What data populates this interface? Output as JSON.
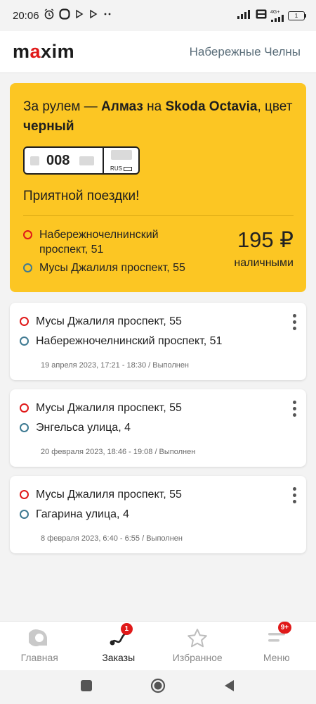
{
  "status_bar": {
    "time": "20:06",
    "network": "4G+",
    "battery": "1"
  },
  "header": {
    "logo_left": "m",
    "logo_accent": "a",
    "logo_right": "xim",
    "city": "Набережные Челны"
  },
  "active_order": {
    "driver_prefix": "За рулем — ",
    "driver_name": "Алмаз",
    "car_prefix": " на ",
    "car": "Skoda Octavia",
    "color_prefix": ", цвет ",
    "color": "черный",
    "plate_number": "008",
    "plate_country": "RUS",
    "greeting": "Приятной поездки!",
    "from": "Набережночелнинский проспект, 51",
    "to": "Мусы Джалиля проспект, 55",
    "price": "195 ₽",
    "payment": "наличными"
  },
  "history": [
    {
      "from": "Мусы Джалиля проспект, 55",
      "to": "Набережночелнинский проспект, 51",
      "meta": "19 апреля 2023, 17:21 - 18:30 / Выполнен"
    },
    {
      "from": "Мусы Джалиля проспект, 55",
      "to": "Энгельса улица, 4",
      "meta": "20 февраля 2023, 18:46 - 19:08 / Выполнен"
    },
    {
      "from": "Мусы Джалиля проспект, 55",
      "to": "Гагарина улица, 4",
      "meta": "8 февраля 2023, 6:40 - 6:55 / Выполнен"
    }
  ],
  "bottom_nav": {
    "home": "Главная",
    "orders": "Заказы",
    "orders_badge": "1",
    "favorites": "Избранное",
    "menu": "Меню",
    "menu_badge": "9+"
  },
  "colors": {
    "accent_yellow": "#fcc623",
    "brand_red": "#e01919",
    "destination_blue": "#3e7a92"
  }
}
